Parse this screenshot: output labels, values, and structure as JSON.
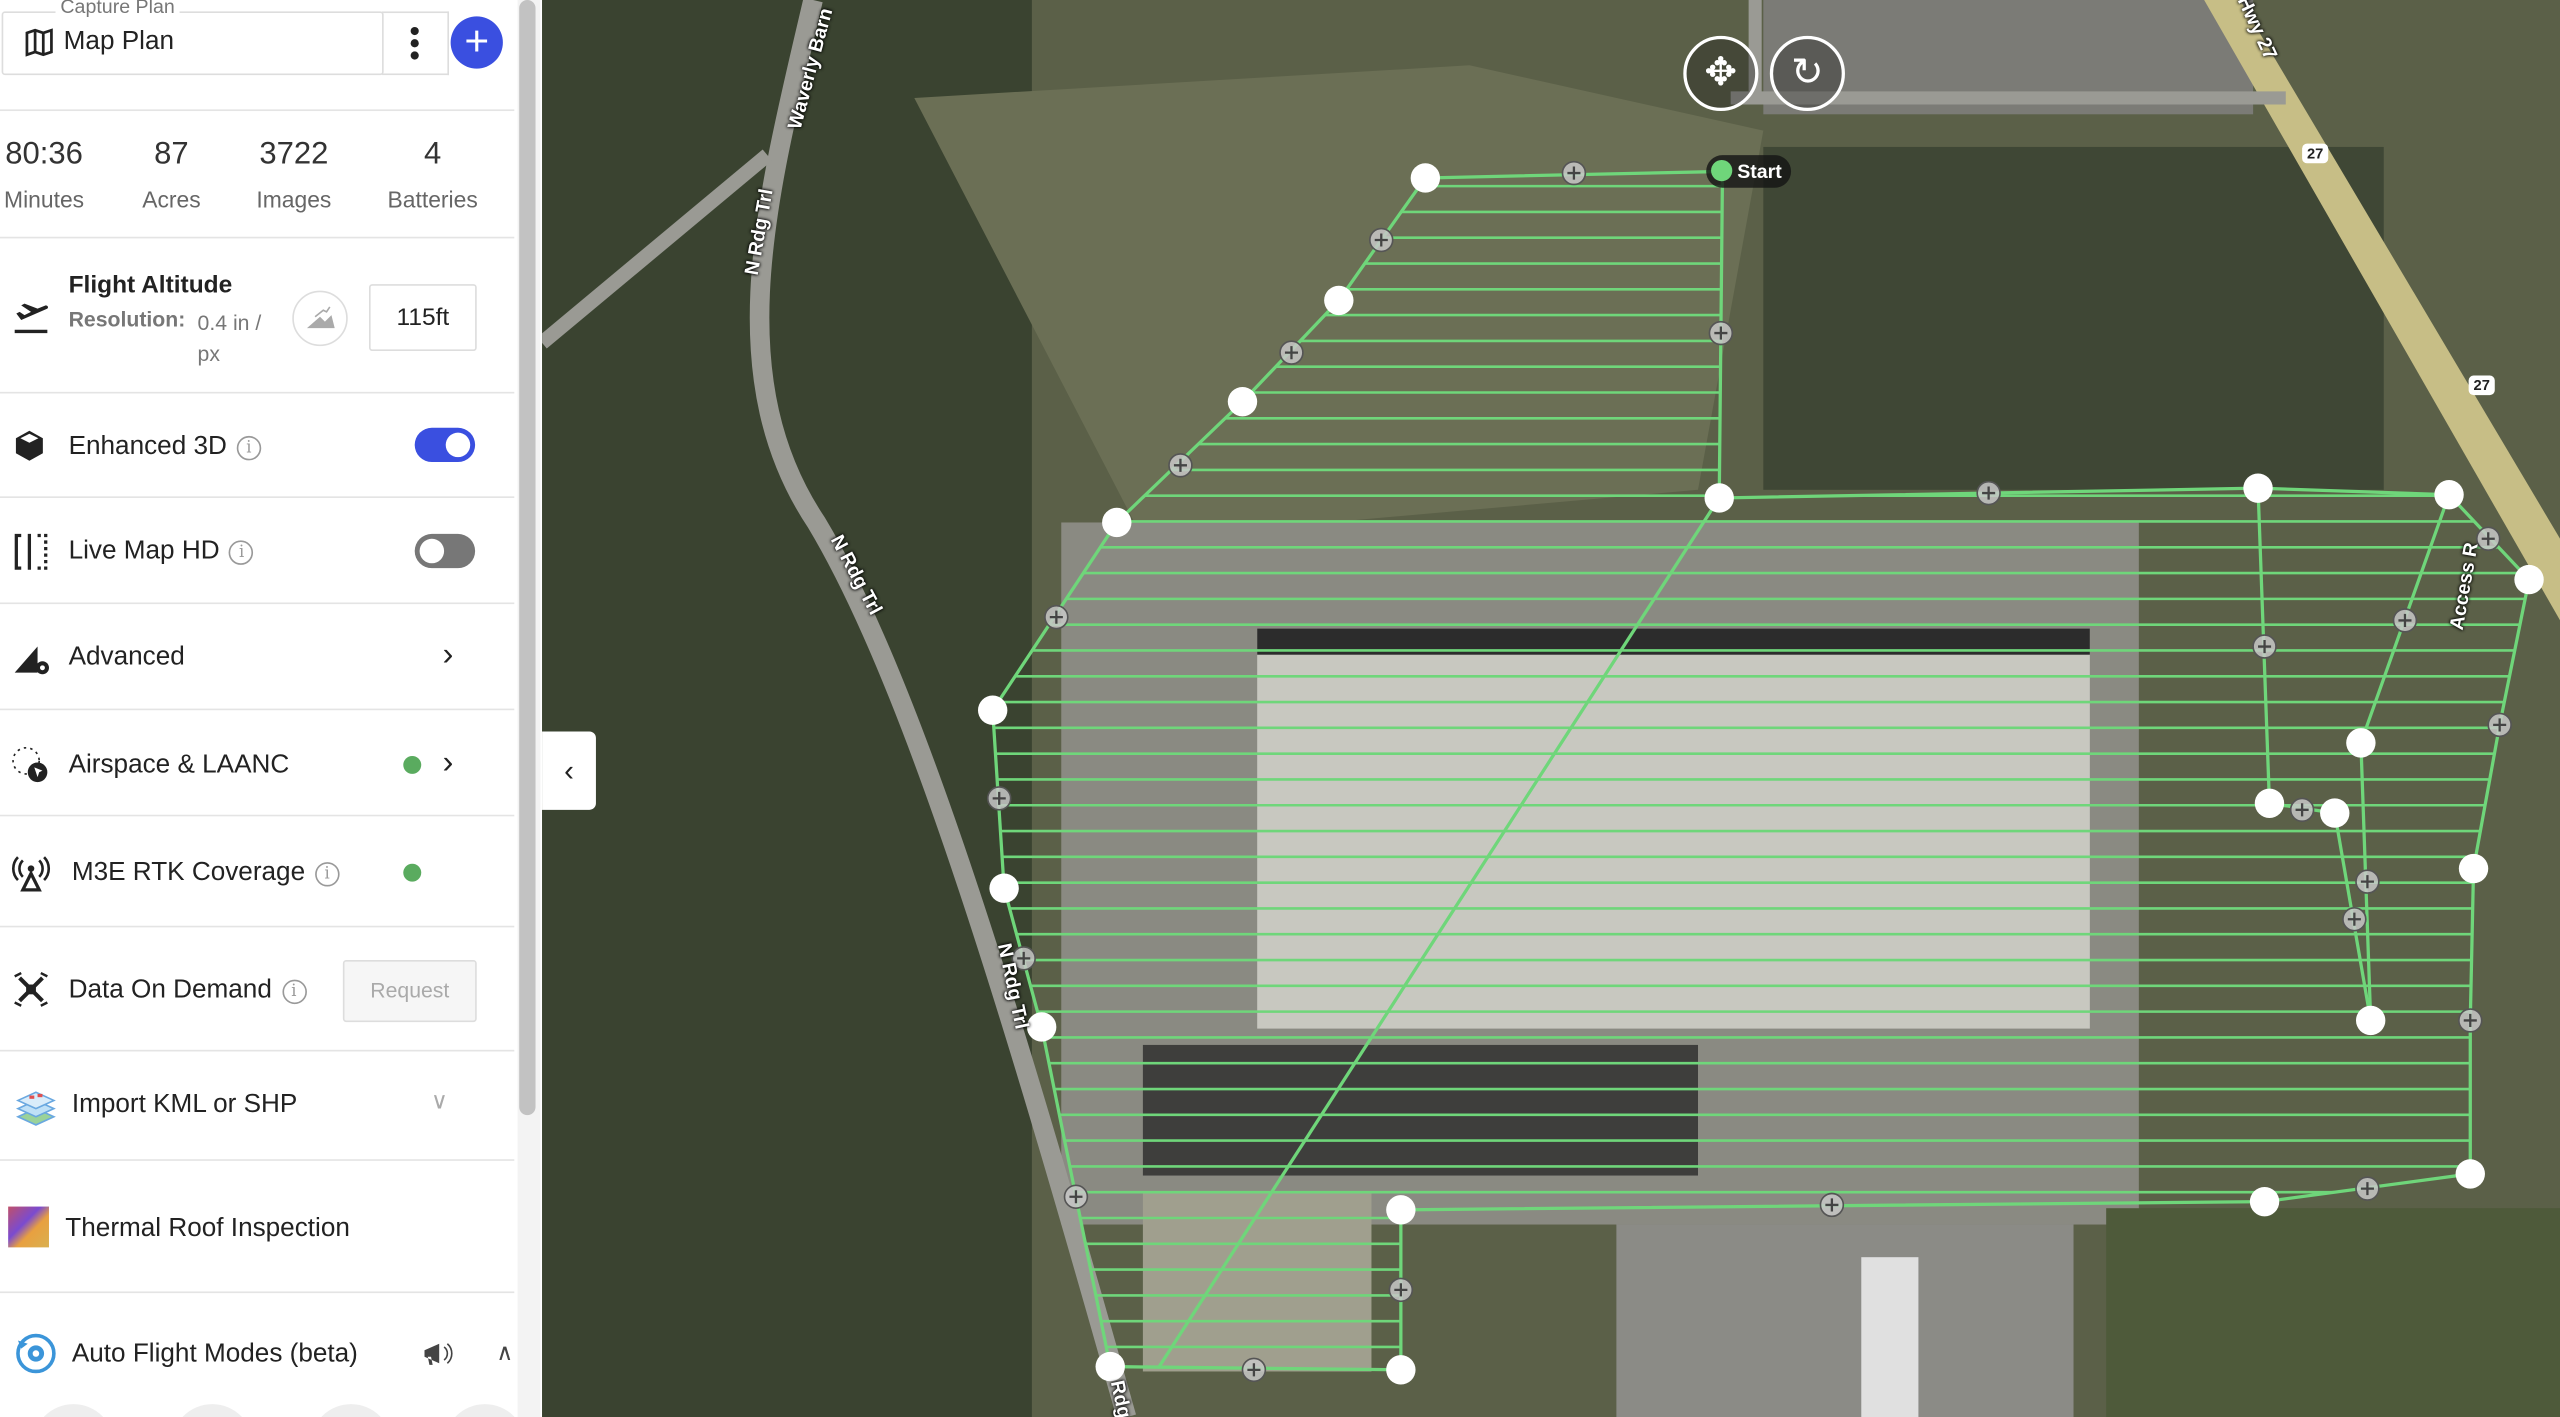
{
  "header": {
    "legend": "Capture Plan",
    "plan_name": "Map Plan",
    "plan_icon": "map-icon",
    "more_icon": "more-vertical-icon",
    "add_icon": "plus-icon",
    "accent": "#3a4fe0"
  },
  "stats": [
    {
      "value": "80:36",
      "label": "Minutes"
    },
    {
      "value": "87",
      "label": "Acres"
    },
    {
      "value": "3722",
      "label": "Images"
    },
    {
      "value": "4",
      "label": "Batteries"
    }
  ],
  "altitude": {
    "title": "Flight Altitude",
    "resolution_label": "Resolution:",
    "resolution_value": "0.4 in / px",
    "value": "115ft"
  },
  "settings": {
    "enhanced_3d": {
      "label": "Enhanced 3D",
      "on": true
    },
    "live_map_hd": {
      "label": "Live Map HD",
      "on": false
    },
    "advanced": {
      "label": "Advanced"
    },
    "airspace": {
      "label": "Airspace & LAANC",
      "status_color": "#5aab5f"
    },
    "rtk": {
      "label": "M3E RTK Coverage",
      "status_color": "#5aab5f"
    },
    "data_on_demand": {
      "label": "Data On Demand",
      "button": "Request"
    },
    "import": {
      "label": "Import KML or SHP"
    },
    "thermal": {
      "label": "Thermal Roof Inspection"
    },
    "auto_flight": {
      "label": "Auto Flight Modes (beta)"
    }
  },
  "map": {
    "start_label": "Start",
    "flight_color": "#6fd67a",
    "labels": {
      "waverly": "Waverly Barn",
      "rdg1": "N Rdg Trl",
      "rdg2": "N Rdg Trl",
      "rdg3": "N Rdg Trl",
      "rdg4": "Rdg",
      "hwy": "Hwy 27",
      "shield1": "27",
      "shield2": "27",
      "access": "Access R"
    }
  }
}
